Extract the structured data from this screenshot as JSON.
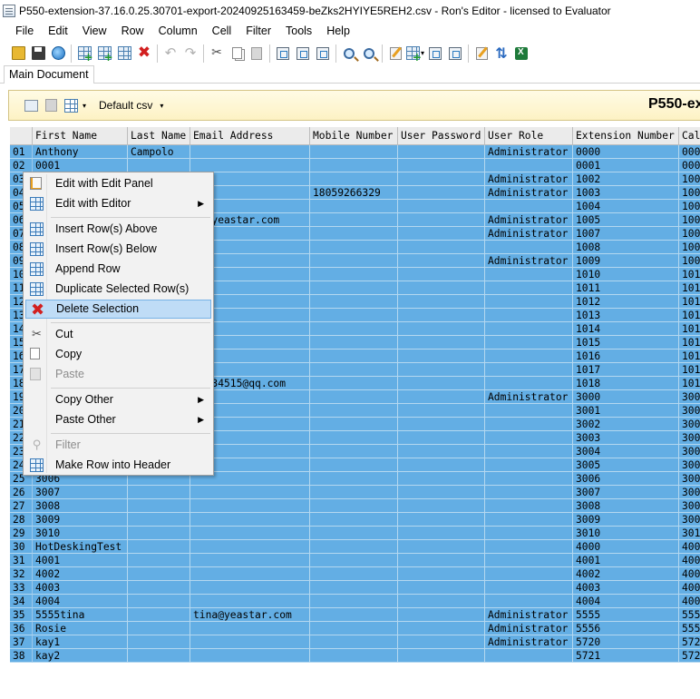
{
  "window": {
    "title": "P550-extension-37.16.0.25.30701-export-20240925163459-beZks2HYIYE5REH2.csv - Ron's Editor - licensed to Evaluator"
  },
  "menubar": [
    "File",
    "Edit",
    "View",
    "Row",
    "Column",
    "Cell",
    "Filter",
    "Tools",
    "Help"
  ],
  "tabs": [
    "Main Document"
  ],
  "docpanel": {
    "format_select": "Default csv",
    "doc_title": "P550-ex"
  },
  "grid": {
    "headers": [
      "",
      "First Name",
      "Last Name",
      "Email Address",
      "Mobile Number",
      "User Password",
      "User Role",
      "Extension Number",
      "Cal"
    ],
    "rows": [
      [
        "01",
        "Anthony",
        "Campolo",
        "",
        "",
        "",
        "Administrator",
        "0000",
        "000"
      ],
      [
        "02",
        "0001",
        "",
        "",
        "",
        "",
        "",
        "0001",
        "000"
      ],
      [
        "03",
        "",
        "",
        "",
        "",
        "",
        "Administrator",
        "1002",
        "100"
      ],
      [
        "04",
        "",
        "",
        "",
        "18059266329",
        "",
        "Administrator",
        "1003",
        "100"
      ],
      [
        "05",
        "",
        "",
        "",
        "",
        "",
        "",
        "1004",
        "100"
      ],
      [
        "06",
        "",
        "",
        "ky@yeastar.com",
        "",
        "",
        "Administrator",
        "1005",
        "100"
      ],
      [
        "07",
        "",
        "",
        "",
        "",
        "",
        "Administrator",
        "1007",
        "100"
      ],
      [
        "08",
        "",
        "",
        "",
        "",
        "",
        "",
        "1008",
        "100"
      ],
      [
        "09",
        "",
        "",
        "",
        "",
        "",
        "Administrator",
        "1009",
        "100"
      ],
      [
        "10",
        "",
        "",
        "",
        "",
        "",
        "",
        "1010",
        "101"
      ],
      [
        "11",
        "",
        "",
        "",
        "",
        "",
        "",
        "1011",
        "101"
      ],
      [
        "12",
        "",
        "",
        "",
        "",
        "",
        "",
        "1012",
        "101"
      ],
      [
        "13",
        "",
        "",
        "",
        "",
        "",
        "",
        "1013",
        "101"
      ],
      [
        "14",
        "",
        "",
        "",
        "",
        "",
        "",
        "1014",
        "101"
      ],
      [
        "15",
        "",
        "",
        "",
        "",
        "",
        "",
        "1015",
        "101"
      ],
      [
        "16",
        "",
        "",
        "",
        "",
        "",
        "",
        "1016",
        "101"
      ],
      [
        "17",
        "",
        "",
        "",
        "",
        "",
        "",
        "1017",
        "101"
      ],
      [
        "18",
        "",
        "",
        "01534515@qq.com",
        "",
        "",
        "",
        "1018",
        "101"
      ],
      [
        "19",
        "",
        "",
        "",
        "",
        "",
        "Administrator",
        "3000",
        "300"
      ],
      [
        "20",
        "",
        "",
        "",
        "",
        "",
        "",
        "3001",
        "300"
      ],
      [
        "21",
        "",
        "",
        "",
        "",
        "",
        "",
        "3002",
        "300"
      ],
      [
        "22",
        "",
        "",
        "",
        "",
        "",
        "",
        "3003",
        "300"
      ],
      [
        "23",
        "",
        "",
        "",
        "",
        "",
        "",
        "3004",
        "300"
      ],
      [
        "24",
        "",
        "",
        "",
        "",
        "",
        "",
        "3005",
        "300"
      ],
      [
        "25",
        "3006",
        "",
        "",
        "",
        "",
        "",
        "3006",
        "300"
      ],
      [
        "26",
        "3007",
        "",
        "",
        "",
        "",
        "",
        "3007",
        "300"
      ],
      [
        "27",
        "3008",
        "",
        "",
        "",
        "",
        "",
        "3008",
        "300"
      ],
      [
        "28",
        "3009",
        "",
        "",
        "",
        "",
        "",
        "3009",
        "300"
      ],
      [
        "29",
        "3010",
        "",
        "",
        "",
        "",
        "",
        "3010",
        "301"
      ],
      [
        "30",
        "HotDeskingTest",
        "",
        "",
        "",
        "",
        "",
        "4000",
        "400"
      ],
      [
        "31",
        "4001",
        "",
        "",
        "",
        "",
        "",
        "4001",
        "400"
      ],
      [
        "32",
        "4002",
        "",
        "",
        "",
        "",
        "",
        "4002",
        "400"
      ],
      [
        "33",
        "4003",
        "",
        "",
        "",
        "",
        "",
        "4003",
        "400"
      ],
      [
        "34",
        "4004",
        "",
        "",
        "",
        "",
        "",
        "4004",
        "400"
      ],
      [
        "35",
        "5555tina",
        "",
        " tina@yeastar.com",
        "",
        "",
        "Administrator",
        "5555",
        "555"
      ],
      [
        "36",
        "Rosie",
        "",
        "",
        "",
        "",
        "Administrator",
        "5556",
        "555"
      ],
      [
        "37",
        "kay1",
        "",
        "",
        "",
        "",
        "Administrator",
        "5720",
        "572"
      ],
      [
        "38",
        "kay2",
        "",
        "",
        "",
        "",
        "",
        "5721",
        "572"
      ]
    ]
  },
  "context_menu": {
    "items": [
      {
        "label": "Edit with Edit Panel",
        "icon": "edit-panel-icon",
        "submenu": false,
        "disabled": false,
        "highlight": false
      },
      {
        "label": "Edit with Editor",
        "icon": "editor-icon",
        "submenu": true,
        "disabled": false,
        "highlight": false
      },
      {
        "sep": true
      },
      {
        "label": "Insert Row(s) Above",
        "icon": "insert-row-above-icon",
        "submenu": false,
        "disabled": false,
        "highlight": false
      },
      {
        "label": "Insert Row(s) Below",
        "icon": "insert-row-below-icon",
        "submenu": false,
        "disabled": false,
        "highlight": false
      },
      {
        "label": "Append Row",
        "icon": "append-row-icon",
        "submenu": false,
        "disabled": false,
        "highlight": false
      },
      {
        "label": "Duplicate Selected Row(s)",
        "icon": "duplicate-row-icon",
        "submenu": false,
        "disabled": false,
        "highlight": false
      },
      {
        "label": "Delete Selection",
        "icon": "delete-icon",
        "submenu": false,
        "disabled": false,
        "highlight": true
      },
      {
        "sep": true
      },
      {
        "label": "Cut",
        "icon": "cut-icon",
        "submenu": false,
        "disabled": false,
        "highlight": false
      },
      {
        "label": "Copy",
        "icon": "copy-icon",
        "submenu": false,
        "disabled": false,
        "highlight": false
      },
      {
        "label": "Paste",
        "icon": "paste-icon",
        "submenu": false,
        "disabled": true,
        "highlight": false
      },
      {
        "sep": true
      },
      {
        "label": "Copy Other",
        "icon": "",
        "submenu": true,
        "disabled": false,
        "highlight": false
      },
      {
        "label": "Paste Other",
        "icon": "",
        "submenu": true,
        "disabled": false,
        "highlight": false
      },
      {
        "sep": true
      },
      {
        "label": "Filter",
        "icon": "filter-icon",
        "submenu": false,
        "disabled": true,
        "highlight": false
      },
      {
        "label": "Make Row into Header",
        "icon": "make-header-icon",
        "submenu": false,
        "disabled": false,
        "highlight": false
      }
    ]
  },
  "colors": {
    "selection": "#63aee4",
    "menu_highlight": "#bfdcf6",
    "delete_red": "#d21f1f",
    "doc_panel": "#fdf2c4"
  }
}
